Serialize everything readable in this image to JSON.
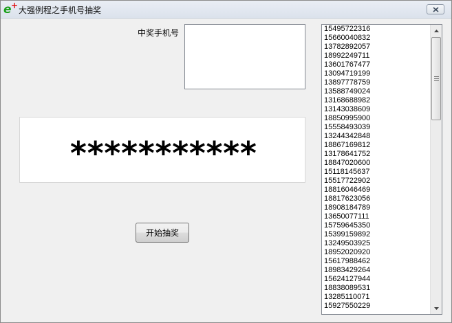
{
  "window": {
    "title": "大强例程之手机号抽奖",
    "icon": "e-language-icon"
  },
  "form": {
    "winner_label": "中奖手机号",
    "winner_value": "",
    "display_text": "***********",
    "start_button_label": "开始抽奖"
  },
  "phone_list": {
    "items": [
      "15495722316",
      "15660040832",
      "13782892057",
      "18992249711",
      "13601767477",
      "13094719199",
      "13897778759",
      "13588749024",
      "13168688982",
      "13143038609",
      "18850995900",
      "15558493039",
      "13244342848",
      "18867169812",
      "13178641752",
      "18847020600",
      "15118145637",
      "15517722902",
      "18816046469",
      "18817623056",
      "18908184789",
      "13650077111",
      "15759645350",
      "15399159892",
      "13249503925",
      "18952020920",
      "15617988462",
      "18983429264",
      "15624127944",
      "18838089531",
      "13285110071",
      "15927550229"
    ]
  }
}
